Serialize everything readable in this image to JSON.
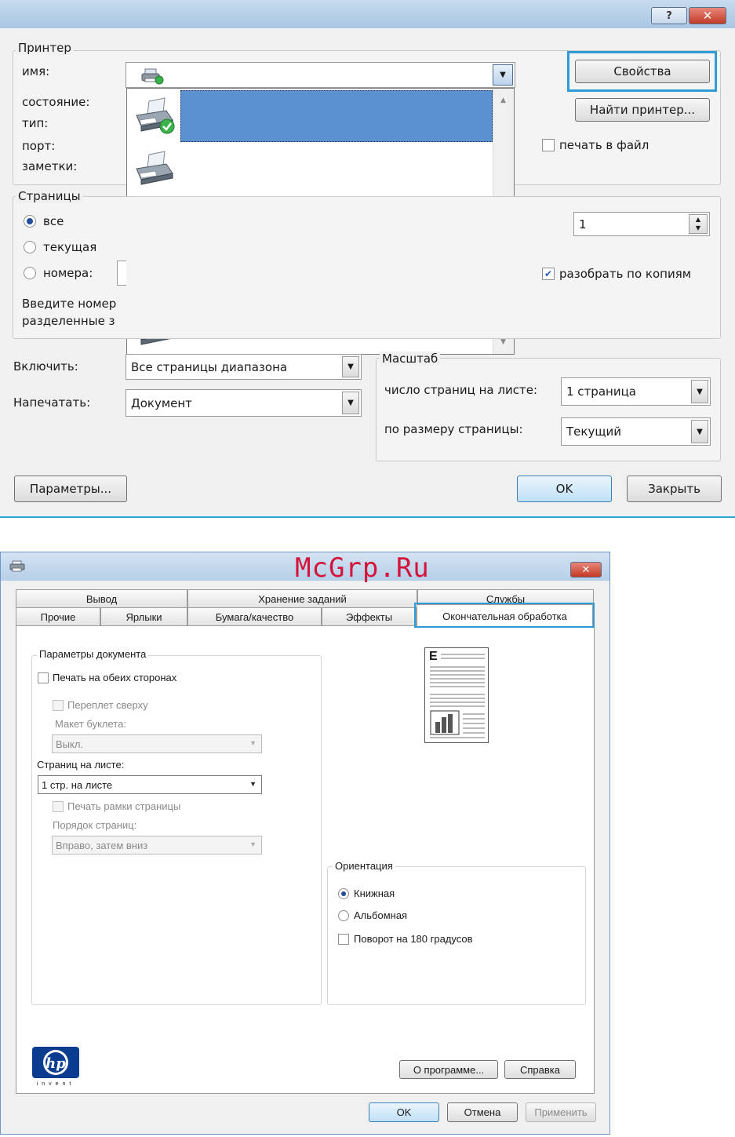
{
  "print_dialog": {
    "help_label": "?",
    "close_label": "✕",
    "printer_group": {
      "title": "Принтер",
      "name_label": "имя:",
      "status_label": "состояние:",
      "type_label": "тип:",
      "port_label": "порт:",
      "comments_label": "заметки:",
      "properties_button": "Свойства",
      "find_printer_button": "Найти принтер...",
      "print_to_file_label": "печать в файл"
    },
    "pages_group": {
      "title": "Страницы",
      "all_label": "все",
      "current_label": "текущая",
      "numbers_label": "номера:",
      "hint_line1": "Введите номер",
      "hint_line2": "разделенные з"
    },
    "copies_value": "1",
    "collate_label": "разобрать по копиям",
    "include_label": "Включить:",
    "include_value": "Все страницы диапазона",
    "print_what_label": "Напечатать:",
    "print_what_value": "Документ",
    "scale_group": {
      "title": "Масштаб",
      "pages_per_sheet_label": "число страниц на листе:",
      "pages_per_sheet_value": "1 страница",
      "scale_to_paper_label": "по размеру страницы:",
      "scale_to_paper_value": "Текущий"
    },
    "options_button": "Параметры...",
    "ok_button": "OK",
    "close_button": "Закрыть"
  },
  "properties_dialog": {
    "watermark": "McGrp.Ru",
    "close_label": "✕",
    "tabs_row1": [
      "Вывод",
      "Хранение заданий",
      "Службы"
    ],
    "tabs_row2": [
      "Прочие",
      "Ярлыки",
      "Бумага/качество",
      "Эффекты",
      "Окончательная обработка"
    ],
    "doc_options": {
      "title": "Параметры документа",
      "duplex_label": "Печать на обеих сторонах",
      "flip_up_label": "Переплет сверху",
      "booklet_label": "Макет буклета:",
      "booklet_value": "Выкл.",
      "pages_per_sheet_label": "Страниц на листе:",
      "pages_per_sheet_value": "1 стр. на листе",
      "borders_label": "Печать рамки страницы",
      "page_order_label": "Порядок страниц:",
      "page_order_value": "Вправо, затем вниз"
    },
    "orientation": {
      "title": "Ориентация",
      "portrait_label": "Книжная",
      "landscape_label": "Альбомная",
      "rotate_label": "Поворот на 180 градусов"
    },
    "preview_letter": "E",
    "logo_text": "invent",
    "about_button": "О программе...",
    "help_button": "Справка",
    "ok_button": "OK",
    "cancel_button": "Отмена",
    "apply_button": "Применить"
  }
}
